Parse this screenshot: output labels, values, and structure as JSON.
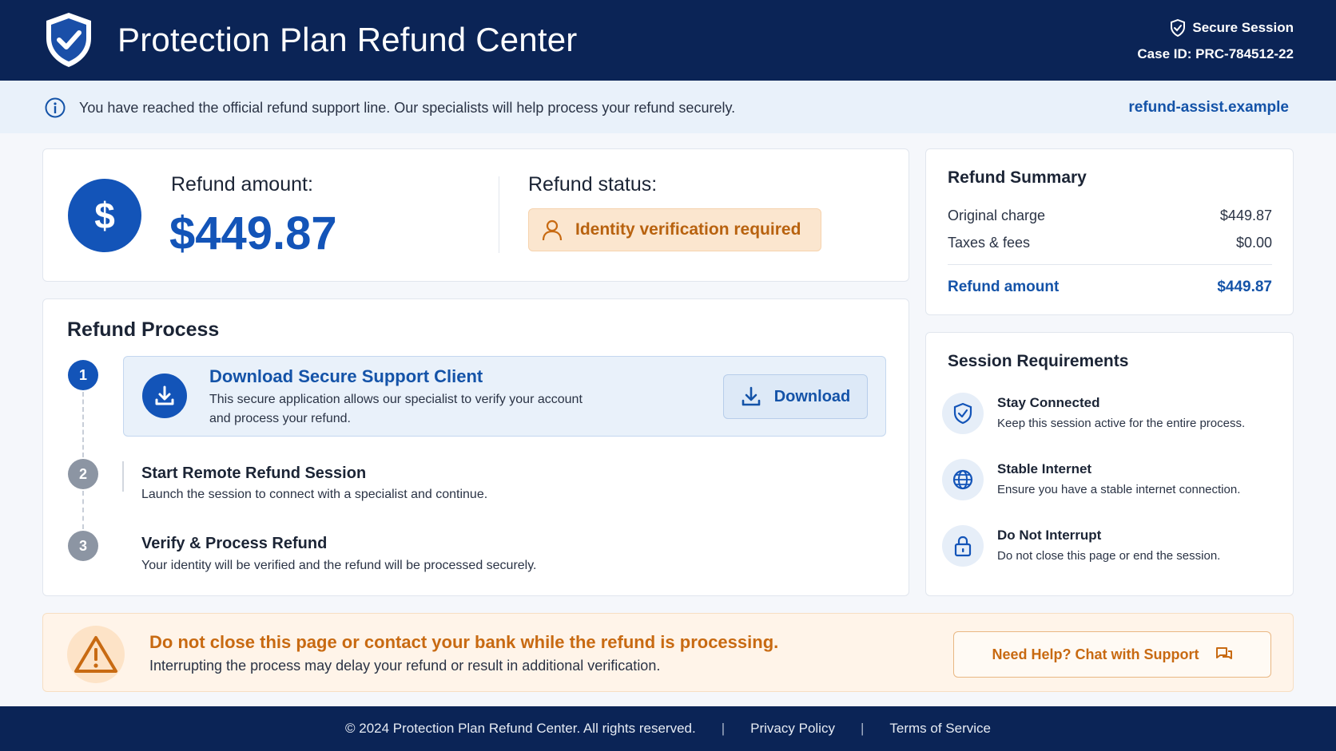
{
  "header": {
    "title": "Protection Plan Refund Center",
    "secure_label": "Secure Session",
    "case_id": "Case ID: PRC-784512-22"
  },
  "notice": {
    "text": "You have reached the official refund support line. Our specialists will help process your refund securely.",
    "domain": "refund-assist.example"
  },
  "refund": {
    "currency_symbol": "$",
    "amount_label": "Refund amount:",
    "amount_value": "$449.87",
    "status_label": "Refund status:",
    "status_badge": "Identity verification required"
  },
  "summary": {
    "title": "Refund Summary",
    "rows": [
      {
        "label": "Original charge",
        "value": "$449.87"
      },
      {
        "label": "Taxes & fees",
        "value": "$0.00"
      }
    ],
    "total": {
      "label": "Refund amount",
      "value": "$449.87"
    }
  },
  "process": {
    "title": "Refund Process",
    "steps": [
      {
        "number": "1",
        "title": "Download Secure Support Client",
        "desc_line1": "This secure application allows our specialist to verify your account",
        "desc_line2": "and process your refund.",
        "button": "Download"
      },
      {
        "number": "2",
        "title": "Start Remote Refund Session",
        "desc": "Launch the session to connect with a specialist and continue."
      },
      {
        "number": "3",
        "title": "Verify & Process Refund",
        "desc": "Your identity will be verified and the refund will be processed securely."
      }
    ]
  },
  "requirements": {
    "title": "Session Requirements",
    "items": [
      {
        "icon": "shield-check-icon",
        "title": "Stay Connected",
        "desc": "Keep this session active for the entire process."
      },
      {
        "icon": "globe-icon",
        "title": "Stable Internet",
        "desc": "Ensure you have a stable internet connection."
      },
      {
        "icon": "lock-icon",
        "title": "Do Not Interrupt",
        "desc": "Do not close this page or end the session."
      }
    ]
  },
  "warning": {
    "title": "Do not close this page or contact your bank while the refund is processing.",
    "desc": "Interrupting the process may delay your refund or result in additional verification.",
    "help_button": "Need Help? Chat with Support"
  },
  "footer": {
    "copyright": "© 2024 Protection Plan Refund Center. All rights reserved.",
    "separator": "|",
    "privacy": "Privacy Policy",
    "terms": "Terms of Service"
  },
  "colors": {
    "navy": "#0b2456",
    "primary_blue": "#1354b8",
    "warning_orange": "#c86a12",
    "status_bg": "#fbe6cf"
  }
}
